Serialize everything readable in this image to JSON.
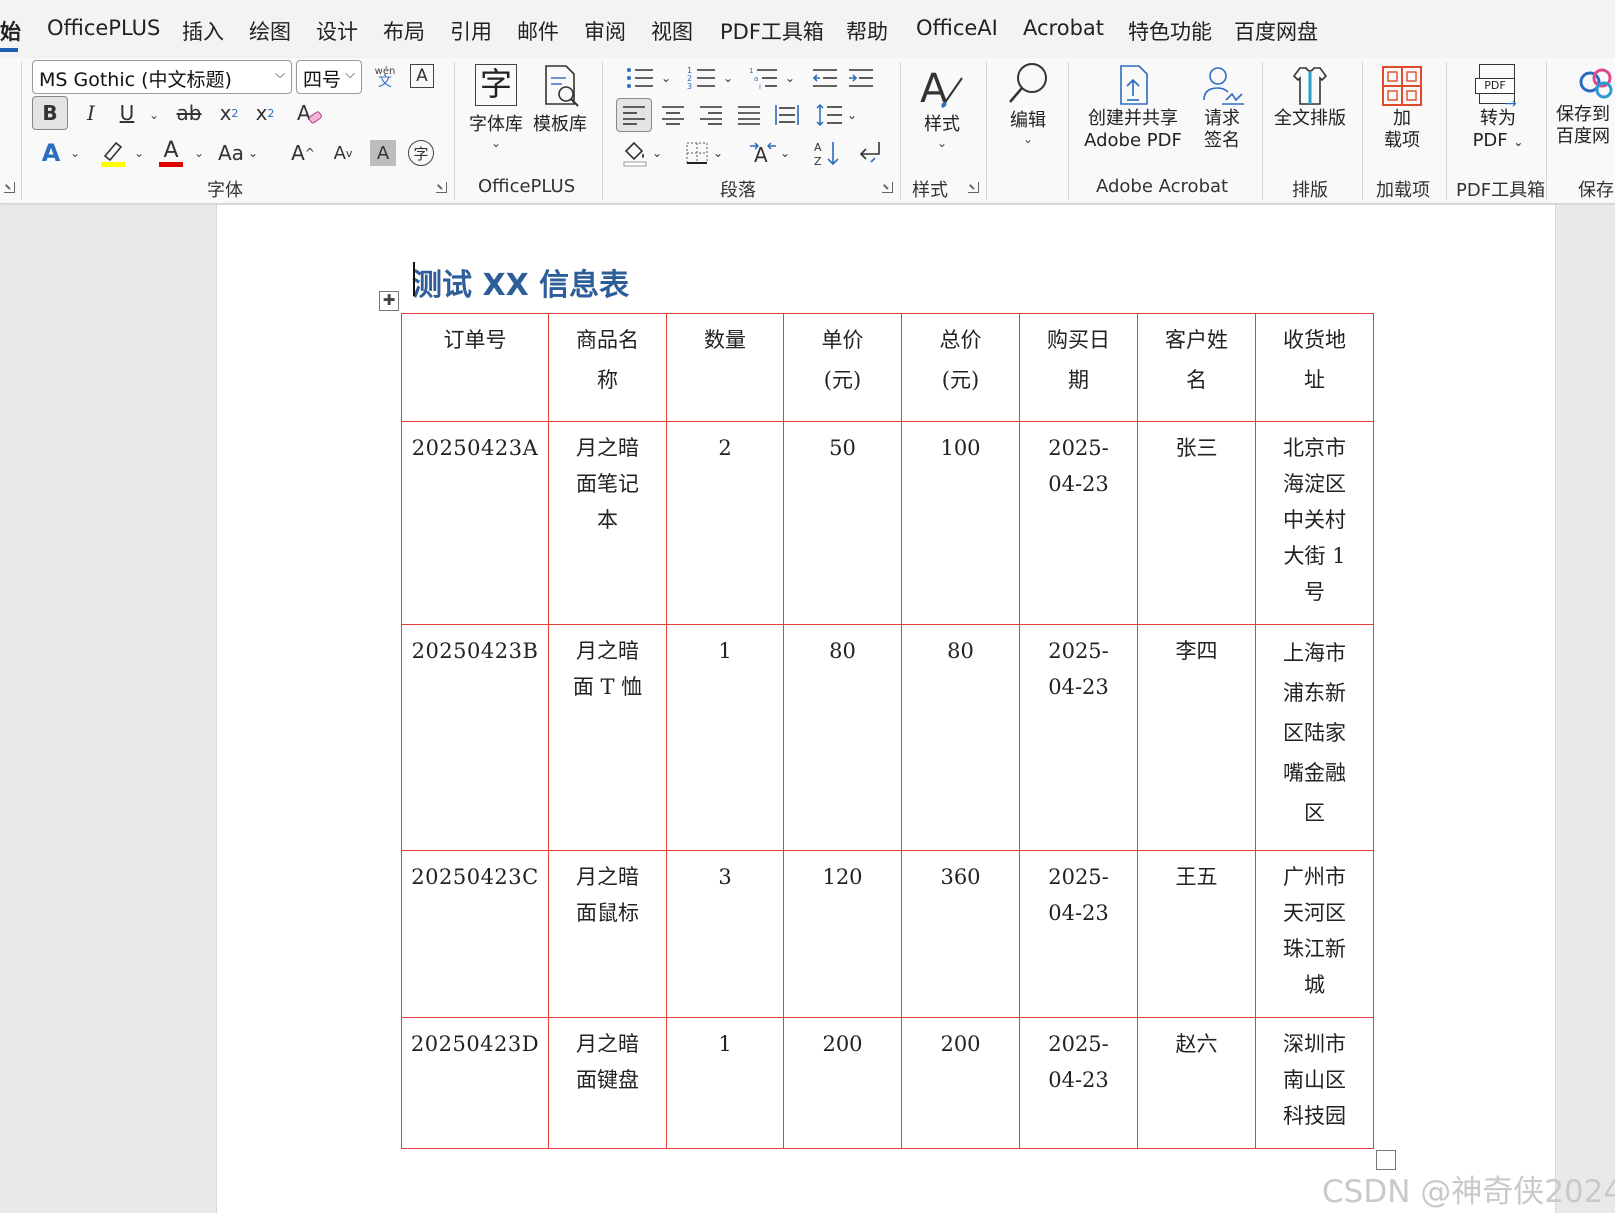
{
  "menu": {
    "tabs": [
      {
        "label": "始",
        "active": true
      },
      {
        "label": "OfficePLUS"
      },
      {
        "label": "插入"
      },
      {
        "label": "绘图"
      },
      {
        "label": "设计"
      },
      {
        "label": "布局"
      },
      {
        "label": "引用"
      },
      {
        "label": "邮件"
      },
      {
        "label": "审阅"
      },
      {
        "label": "视图"
      },
      {
        "label": "PDF工具箱"
      },
      {
        "label": "帮助"
      },
      {
        "label": "OfficeAI"
      },
      {
        "label": "Acrobat"
      },
      {
        "label": "特色功能"
      },
      {
        "label": "百度网盘"
      }
    ]
  },
  "ribbon": {
    "font": {
      "font_name": "MS Gothic (中文标题)",
      "font_size": "四号",
      "group_label": "字体",
      "bold": "B",
      "italic": "I",
      "underline": "U",
      "strike": "ab",
      "subscript": "x",
      "subscript_mark": "2",
      "superscript": "x",
      "superscript_mark": "2",
      "text_effect": "A",
      "font_color": "A",
      "case": "Aa",
      "grow": "A",
      "shrink": "A",
      "shade": "A",
      "enclose": "字",
      "phonetic_top": "wén",
      "phonetic_bottom": "文",
      "border_char": "A",
      "highlight_color": "#ffff00",
      "font_color_value": "#e00000"
    },
    "officeplus": {
      "group_label": "OfficePLUS",
      "font_lib": "字体库",
      "font_lib_glyph": "字",
      "template_lib": "模板库"
    },
    "paragraph": {
      "group_label": "段落"
    },
    "styles": {
      "group_label": "样式",
      "button": "样式"
    },
    "editing": {
      "button": "编辑"
    },
    "adobe": {
      "group_label": "Adobe Acrobat",
      "create_share": "创建并共享",
      "create_share_2": "Adobe PDF",
      "request_sign": "请求",
      "request_sign_2": "签名"
    },
    "layout": {
      "group_label": "排版",
      "full_layout": "全文排版"
    },
    "addins": {
      "group_label": "加载项",
      "button": "加",
      "button_2": "载项"
    },
    "pdftools": {
      "group_label": "PDF工具箱",
      "convert": "转为",
      "convert_2": "PDF",
      "pdf_badge": "PDF"
    },
    "save": {
      "group_label": "保存",
      "button": "保存到",
      "button_2": "百度网"
    }
  },
  "document": {
    "title": "测试 XX 信息表",
    "table": {
      "headers": [
        "订单号",
        "商品名称",
        "数量",
        "单价(元)",
        "总价(元)",
        "购买日期",
        "客户姓名",
        "收货地址"
      ],
      "header_lines": [
        [
          "订单号"
        ],
        [
          "商品名",
          "称"
        ],
        [
          "数量"
        ],
        [
          "单价",
          "(元)"
        ],
        [
          "总价",
          "(元)"
        ],
        [
          "购买日",
          "期"
        ],
        [
          "客户姓",
          "名"
        ],
        [
          "收货地",
          "址"
        ]
      ],
      "rows": [
        {
          "order": "20250423A",
          "product": [
            "月之暗",
            "面笔记",
            "本"
          ],
          "qty": "2",
          "price": "50",
          "total": "100",
          "date": [
            "2025-",
            "04-23"
          ],
          "customer": "张三",
          "address": [
            "北京市",
            "海淀区",
            "中关村",
            "大街 1",
            "号"
          ]
        },
        {
          "order": "20250423B",
          "product": [
            "月之暗",
            "面 T 恤"
          ],
          "qty": "1",
          "price": "80",
          "total": "80",
          "date": [
            "2025-",
            "04-23"
          ],
          "customer": "李四",
          "address": [
            "上海市",
            "浦东新",
            "区陆家",
            "嘴金融",
            "区"
          ]
        },
        {
          "order": "20250423C",
          "product": [
            "月之暗",
            "面鼠标"
          ],
          "qty": "3",
          "price": "120",
          "total": "360",
          "date": [
            "2025-",
            "04-23"
          ],
          "customer": "王五",
          "address": [
            "广州市",
            "天河区",
            "珠江新",
            "城"
          ]
        },
        {
          "order": "20250423D",
          "product": [
            "月之暗",
            "面键盘"
          ],
          "qty": "1",
          "price": "200",
          "total": "200",
          "date": [
            "2025-",
            "04-23"
          ],
          "customer": "赵六",
          "address": [
            "深圳市",
            "南山区",
            "科技园"
          ]
        }
      ],
      "border_color": "#e0413b"
    }
  },
  "watermark": "CSDN @神奇侠2024",
  "colors": {
    "title": "#2e5e9a",
    "accent": "#1e5fb4",
    "table_border": "#e0413b"
  }
}
